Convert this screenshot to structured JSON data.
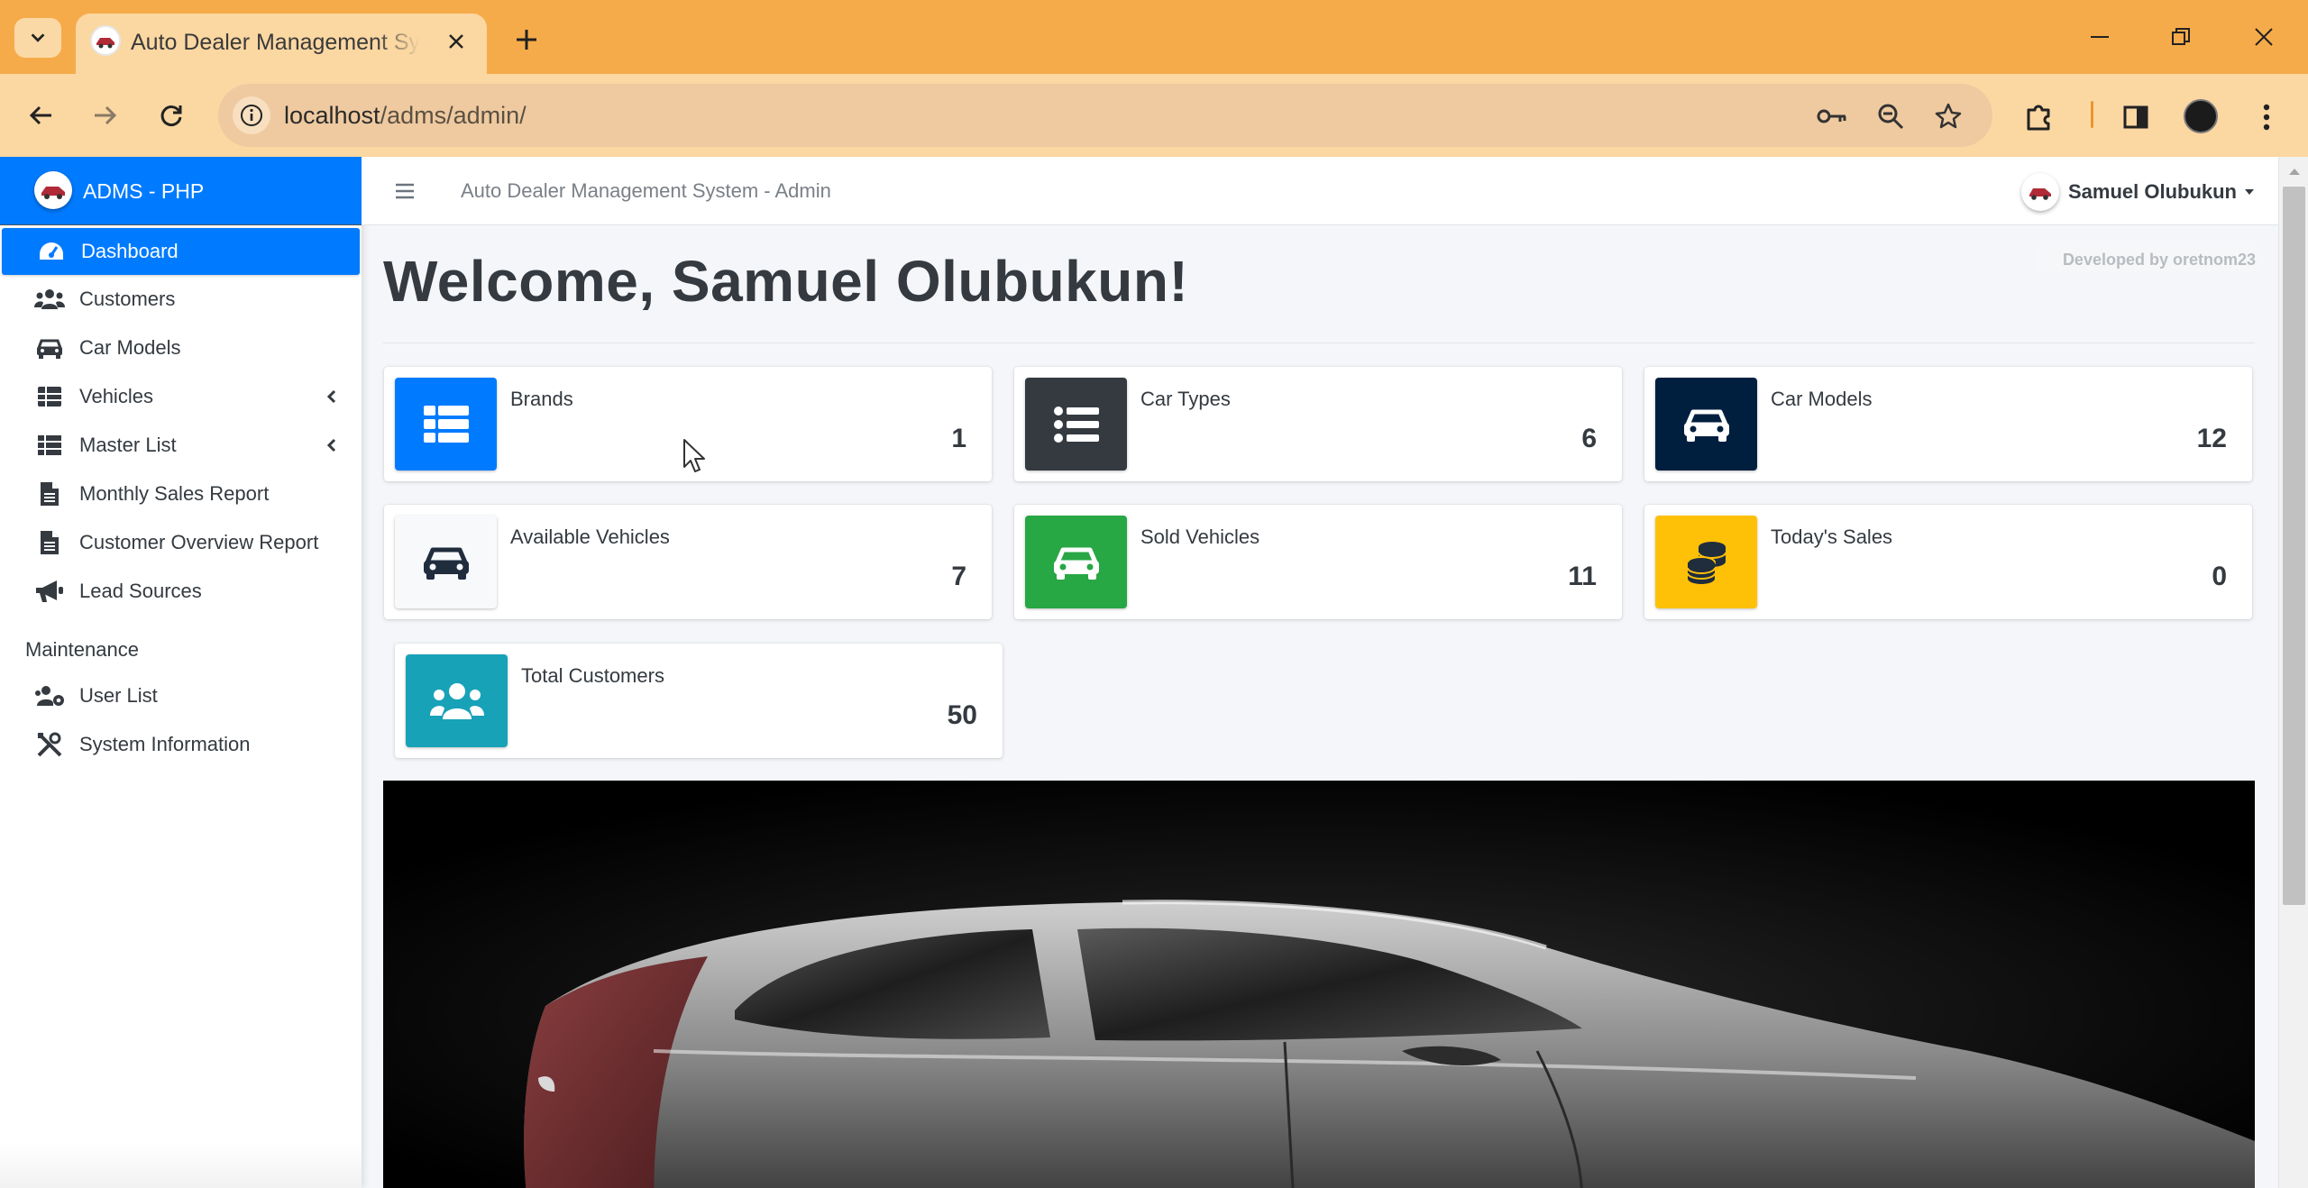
{
  "browser": {
    "tab_title": "Auto Dealer Management System - Admin",
    "url_host": "localhost",
    "url_path": "/adms/admin/",
    "tabstrip_color": "#f6ab4a",
    "toolbar_color": "#fbd7a2"
  },
  "sidebar": {
    "brand": "ADMS - PHP",
    "accent": "#007bff",
    "items": [
      {
        "label": "Dashboard",
        "icon": "tachometer-icon",
        "active": true
      },
      {
        "label": "Customers",
        "icon": "users-icon"
      },
      {
        "label": "Car Models",
        "icon": "car-icon"
      },
      {
        "label": "Vehicles",
        "icon": "th-icon",
        "has_submenu": true
      },
      {
        "label": "Master List",
        "icon": "list-icon",
        "has_submenu": true
      },
      {
        "label": "Monthly Sales Report",
        "icon": "file-icon"
      },
      {
        "label": "Customer Overview Report",
        "icon": "file-icon"
      },
      {
        "label": "Lead Sources",
        "icon": "bullhorn-icon"
      }
    ],
    "maintenance_header": "Maintenance",
    "maintenance_items": [
      {
        "label": "User List",
        "icon": "users-cog-icon"
      },
      {
        "label": "System Information",
        "icon": "tools-icon"
      }
    ]
  },
  "navbar": {
    "title": "Auto Dealer Management System - Admin",
    "user_name": "Samuel Olubukun"
  },
  "content": {
    "welcome": "Welcome, Samuel Olubukun!",
    "dev_credit": "Developed by oretnom23",
    "stats": [
      {
        "label": "Brands",
        "value": "1",
        "color": "#007bff",
        "icon": "th-list-icon"
      },
      {
        "label": "Car Types",
        "value": "6",
        "color": "#343a40",
        "icon": "list-icon"
      },
      {
        "label": "Car Models",
        "value": "12",
        "color": "#001f3f",
        "icon": "car-icon"
      },
      {
        "label": "Available Vehicles",
        "value": "7",
        "color": "#f8f9fa",
        "icon": "car-icon"
      },
      {
        "label": "Sold Vehicles",
        "value": "11",
        "color": "#28a745",
        "icon": "car-icon"
      },
      {
        "label": "Today's Sales",
        "value": "0",
        "color": "#ffc107",
        "icon": "coins-icon"
      },
      {
        "label": "Total Customers",
        "value": "50",
        "color": "#17a2b8",
        "icon": "users-icon"
      }
    ]
  }
}
